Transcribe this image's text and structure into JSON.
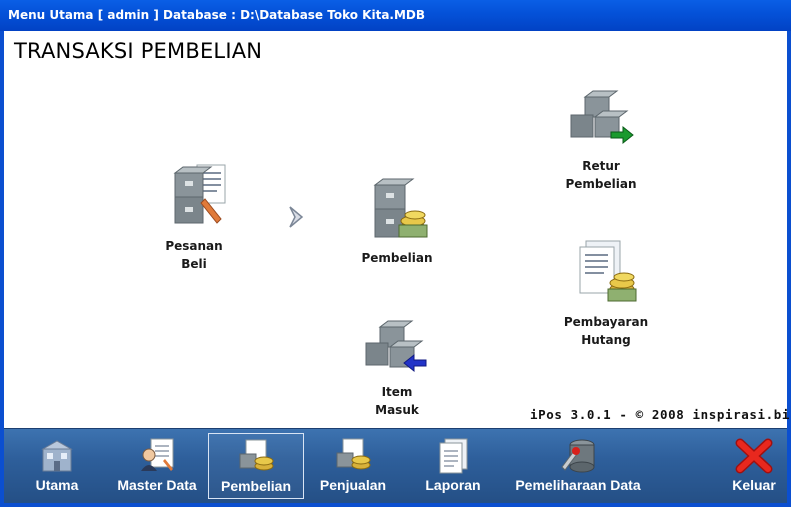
{
  "window": {
    "title": "Menu Utama [ admin ] Database : D:\\Database Toko Kita.MDB"
  },
  "page": {
    "title": "TRANSAKSI PEMBELIAN"
  },
  "modules": {
    "pesanan_beli": {
      "line1": "Pesanan",
      "line2": "Beli"
    },
    "pembelian": {
      "label": "Pembelian"
    },
    "item_masuk": {
      "line1": "Item",
      "line2": "Masuk"
    },
    "retur_pembelian": {
      "line1": "Retur",
      "line2": "Pembelian"
    },
    "pembayaran_hutang": {
      "line1": "Pembayaran",
      "line2": "Hutang"
    }
  },
  "footer": {
    "version": "iPos 3.0.1 - © 2008 inspirasi.bi"
  },
  "toolbar": {
    "active": "Pembelian",
    "items": [
      {
        "label": "Utama",
        "icon": "building-icon"
      },
      {
        "label": "Master Data",
        "icon": "user-document-icon"
      },
      {
        "label": "Pembelian",
        "icon": "boxes-coins-icon"
      },
      {
        "label": "Penjualan",
        "icon": "boxes-coins-icon"
      },
      {
        "label": "Laporan",
        "icon": "report-icon"
      },
      {
        "label": "Pemeliharaan Data",
        "icon": "database-tools-icon"
      },
      {
        "label": "Keluar",
        "icon": "close-icon"
      }
    ]
  },
  "colors": {
    "titlebar": "#0451d8",
    "toolbar": "#2e5f9b",
    "box": "#7f8a90",
    "arrow_green": "#1a9a2e",
    "arrow_blue": "#2233c8",
    "coin": "#d8b13a",
    "close_red": "#d8201a"
  }
}
